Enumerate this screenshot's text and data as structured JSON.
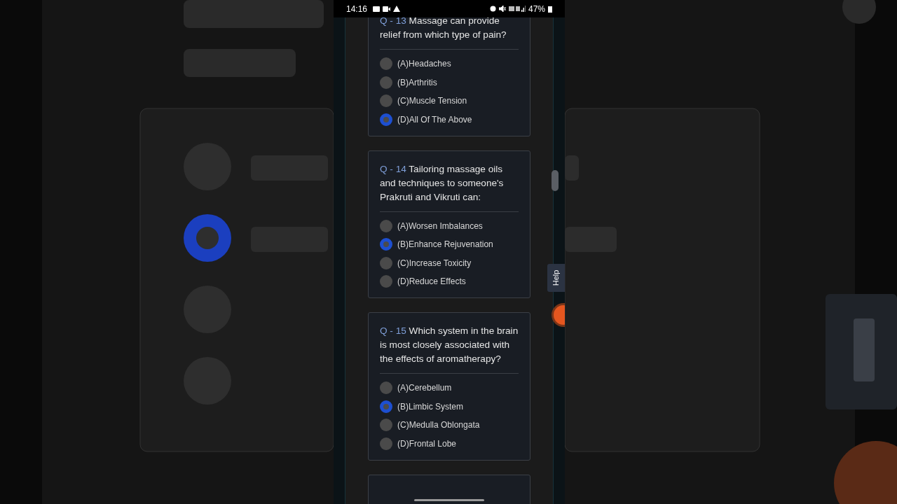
{
  "status_bar": {
    "time": "14:16",
    "battery": "47%"
  },
  "questions": [
    {
      "number": "Q - 13",
      "text": "Massage can provide relief from which type of pain?",
      "options": [
        {
          "label": "(A)Headaches",
          "selected": false
        },
        {
          "label": "(B)Arthritis",
          "selected": false
        },
        {
          "label": "(C)Muscle Tension",
          "selected": false
        },
        {
          "label": "(D)All Of The Above",
          "selected": true
        }
      ]
    },
    {
      "number": "Q - 14",
      "text": "Tailoring massage oils and techniques to someone's Prakruti and Vikruti can:",
      "options": [
        {
          "label": "(A)Worsen Imbalances",
          "selected": false
        },
        {
          "label": "(B)Enhance Rejuvenation",
          "selected": true
        },
        {
          "label": "(C)Increase Toxicity",
          "selected": false
        },
        {
          "label": "(D)Reduce Effects",
          "selected": false
        }
      ]
    },
    {
      "number": "Q - 15",
      "text": "Which system in the brain is most closely associated with the effects of aromatherapy?",
      "options": [
        {
          "label": "(A)Cerebellum",
          "selected": false
        },
        {
          "label": "(B)Limbic System",
          "selected": true
        },
        {
          "label": "(C)Medulla Oblongata",
          "selected": false
        },
        {
          "label": "(D)Frontal Lobe",
          "selected": false
        }
      ]
    }
  ],
  "help_tab": {
    "label": "Help"
  }
}
